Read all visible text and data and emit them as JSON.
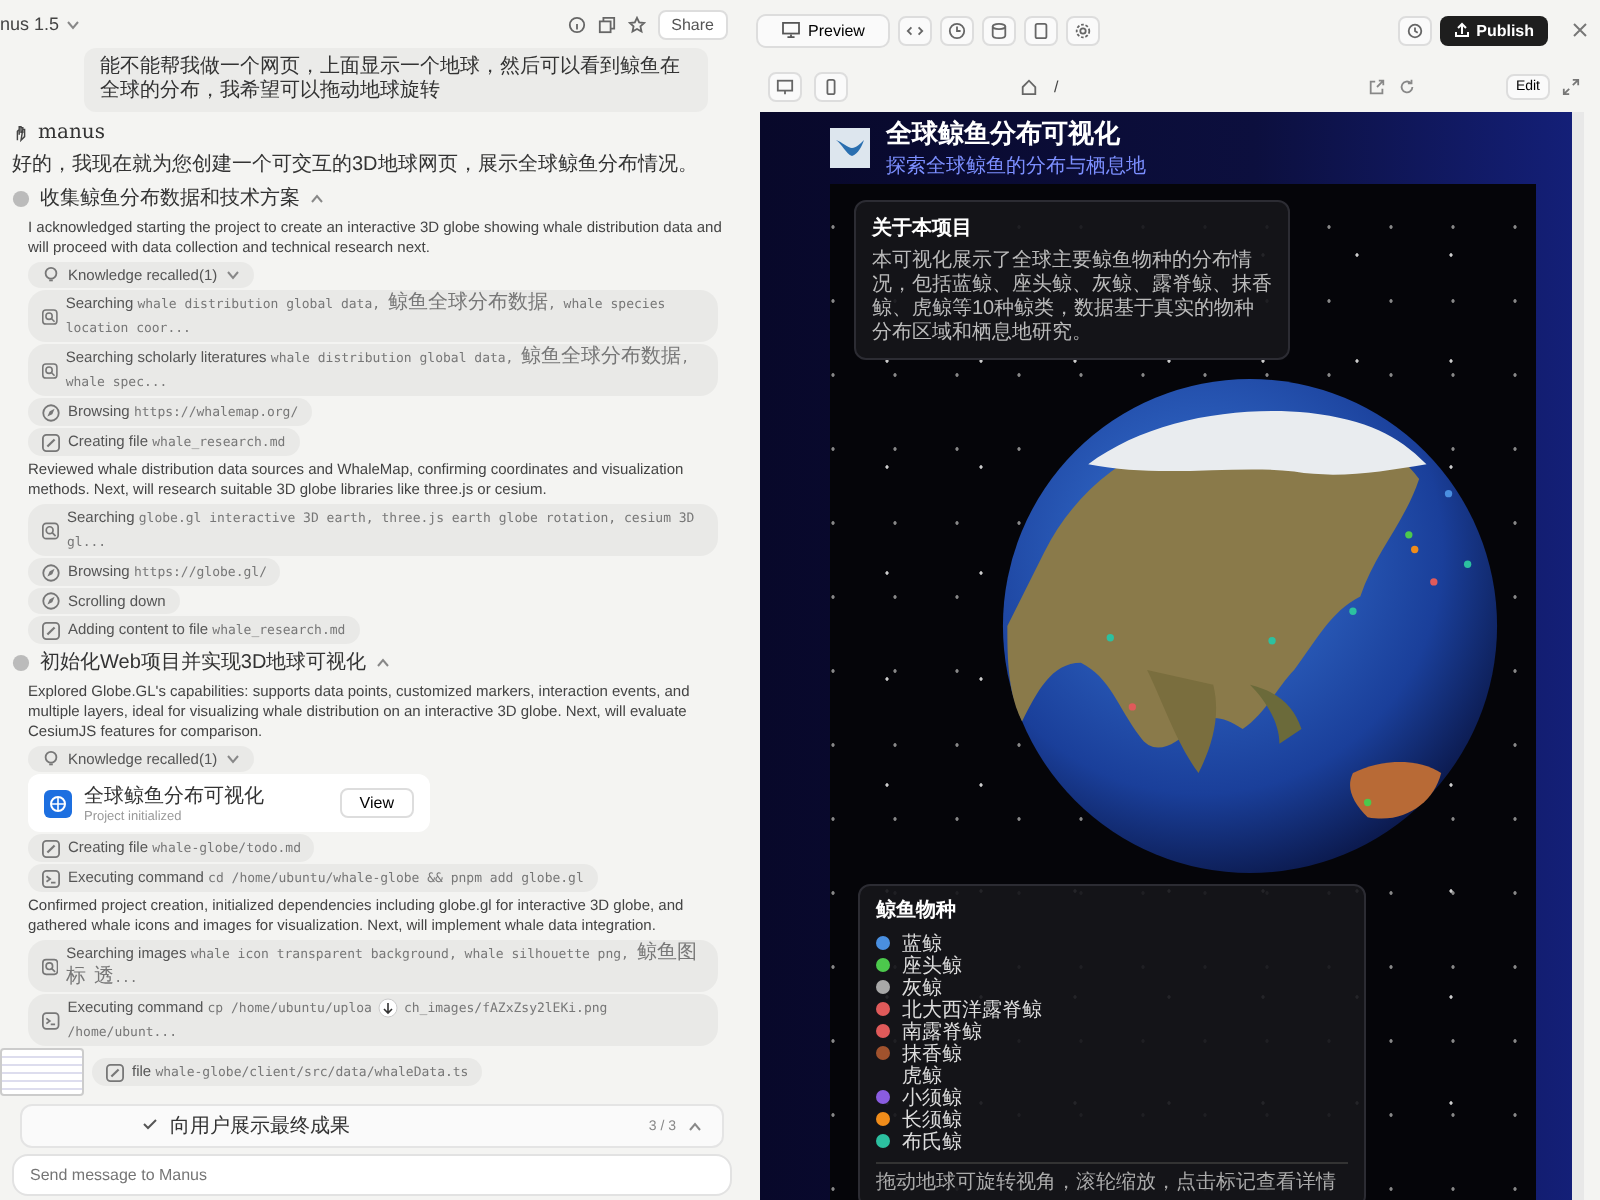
{
  "chat": {
    "model": "nus 1.5",
    "share": "Share",
    "user_message": "能不能帮我做一个网页，上面显示一个地球，然后可以看到鲸鱼在全球的分布，我希望可以拖动地球旋转",
    "assistant_name": "manus",
    "reply": "好的，我现在就为您创建一个可交互的3D地球网页，展示全球鲸鱼分布情况。",
    "steps": [
      {
        "title": "收集鲸鱼分布数据和技术方案",
        "expanded": true,
        "items": [
          {
            "kind": "text",
            "text": "I acknowledged starting the project to create an interactive 3D globe showing whale distribution data and will proceed with data collection and technical research next."
          },
          {
            "kind": "knowledge",
            "action": "Knowledge recalled(1)",
            "expanded": false
          },
          {
            "kind": "search",
            "action": "Searching",
            "detail": "whale distribution global data, 鲸鱼全球分布数据, whale species location coor..."
          },
          {
            "kind": "search",
            "action": "Searching scholarly literatures",
            "detail": "whale distribution global data, 鲸鱼全球分布数据, whale spec..."
          },
          {
            "kind": "browse",
            "action": "Browsing",
            "detail": "https://whalemap.org/"
          },
          {
            "kind": "file",
            "action": "Creating file",
            "detail": "whale_research.md"
          },
          {
            "kind": "text",
            "text": "Reviewed whale distribution data sources and WhaleMap, confirming coordinates and visualization methods. Next, will research suitable 3D globe libraries like three.js or cesium."
          },
          {
            "kind": "search",
            "action": "Searching",
            "detail": "globe.gl interactive 3D earth, three.js earth globe rotation, cesium 3D gl..."
          },
          {
            "kind": "browse",
            "action": "Browsing",
            "detail": "https://globe.gl/"
          },
          {
            "kind": "browse",
            "action": "Scrolling down"
          },
          {
            "kind": "file",
            "action": "Adding content to file",
            "detail": "whale_research.md"
          }
        ]
      },
      {
        "title": "初始化Web项目并实现3D地球可视化",
        "expanded": true,
        "items": [
          {
            "kind": "text",
            "text": "Explored Globe.GL's capabilities: supports data points, customized markers, interaction events, and multiple layers, ideal for visualizing whale distribution on an interactive 3D globe. Next, will evaluate CesiumJS features for comparison."
          },
          {
            "kind": "knowledge",
            "action": "Knowledge recalled(1)",
            "expanded": false
          },
          {
            "kind": "project",
            "title": "全球鲸鱼分布可视化",
            "subtitle": "Project initialized",
            "button": "View"
          },
          {
            "kind": "file",
            "action": "Creating file",
            "detail": "whale-globe/todo.md"
          },
          {
            "kind": "terminal",
            "action": "Executing command",
            "detail": "cd /home/ubuntu/whale-globe && pnpm add globe.gl"
          },
          {
            "kind": "text",
            "text": "Confirmed project creation, initialized dependencies including globe.gl for interactive 3D globe, and gathered whale icons and images for visualization. Next, will implement whale data integration."
          },
          {
            "kind": "search",
            "action": "Searching images",
            "detail": "whale icon transparent background, whale silhouette png, 鲸鱼图标 透..."
          },
          {
            "kind": "terminal",
            "action": "Executing command",
            "detail": "cp /home/ubuntu/uploa",
            "detail_2": "ch_images/fAZxZsy2lEKi.png /home/ubunt..."
          },
          {
            "kind": "file",
            "action": "file",
            "detail": "whale-globe/client/src/data/whaleData.ts"
          }
        ]
      }
    ],
    "task": {
      "label": "向用户展示最终成果",
      "progress": "3 / 3",
      "done": true
    },
    "input": {
      "placeholder": "Send message to Manus"
    }
  },
  "preview": {
    "toolbar": {
      "preview": "Preview",
      "publish": "Publish"
    },
    "address": "/",
    "edit": "Edit",
    "header": {
      "title": "全球鲸鱼分布可视化",
      "subtitle": "探索全球鲸鱼的分布与栖息地"
    },
    "about": {
      "title": "关于本项目",
      "text": "本可视化展示了全球主要鲸鱼物种的分布情况，包括蓝鲸、座头鲸、灰鲸、露脊鲸、抹香鲸、虎鲸等10种鲸类，数据基于真实的物种分布区域和栖息地研究。"
    },
    "legend": {
      "title": "鲸鱼物种",
      "items": [
        {
          "name": "蓝鲸",
          "color": "#4a8fe0"
        },
        {
          "name": "座头鲸",
          "color": "#4cc94c"
        },
        {
          "name": "灰鲸",
          "color": "#a8a8a8"
        },
        {
          "name": "北大西洋露脊鲸",
          "color": "#e05a5a"
        },
        {
          "name": "南露脊鲸",
          "color": "#e05a5a"
        },
        {
          "name": "抹香鲸",
          "color": "#a0522d"
        },
        {
          "name": "虎鲸"
        },
        {
          "name": "小须鲸",
          "color": "#8a5ce0"
        },
        {
          "name": "长须鲸",
          "color": "#f08c1a"
        },
        {
          "name": "布氏鲸",
          "color": "#2cc0a0"
        }
      ],
      "hint": "拖动地球可旋转视角，滚轮缩放，点击标记查看详情"
    }
  }
}
